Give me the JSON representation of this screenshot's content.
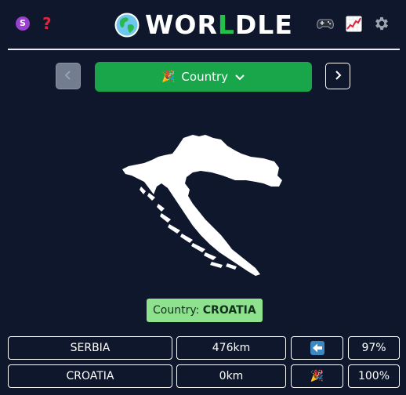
{
  "header": {
    "avatar_letter": "S",
    "help_glyph": "?",
    "logo_prefix": "WOR",
    "logo_highlight": "L",
    "logo_suffix": "DLE",
    "icons": [
      "avatar-icon",
      "question-mark-icon",
      "globe-icon",
      "gamepad-icon",
      "chart-icon",
      "gear-icon"
    ]
  },
  "mode": {
    "emoji": "🎉",
    "label": "Country",
    "icons": [
      "chevron-left-icon",
      "party-popper-icon",
      "chevron-down-icon",
      "chevron-right-icon"
    ]
  },
  "answer": {
    "prefix": "Country: ",
    "value": "CROATIA"
  },
  "guesses": [
    {
      "country": "SERBIA",
      "distance": "476km",
      "direction": "⬅️",
      "direction_icon": "arrow-left-icon",
      "proximity": "97%"
    },
    {
      "country": "CROATIA",
      "distance": "0km",
      "direction": "🎉",
      "direction_icon": "party-popper-icon",
      "proximity": "100%"
    }
  ],
  "colors": {
    "background": "#0e172b",
    "mode_button": "#19a54a",
    "answer_badge": "#8ee28e",
    "logo_green": "#22c24a",
    "avatar": "#9b3fd1",
    "help": "#e3233b"
  }
}
